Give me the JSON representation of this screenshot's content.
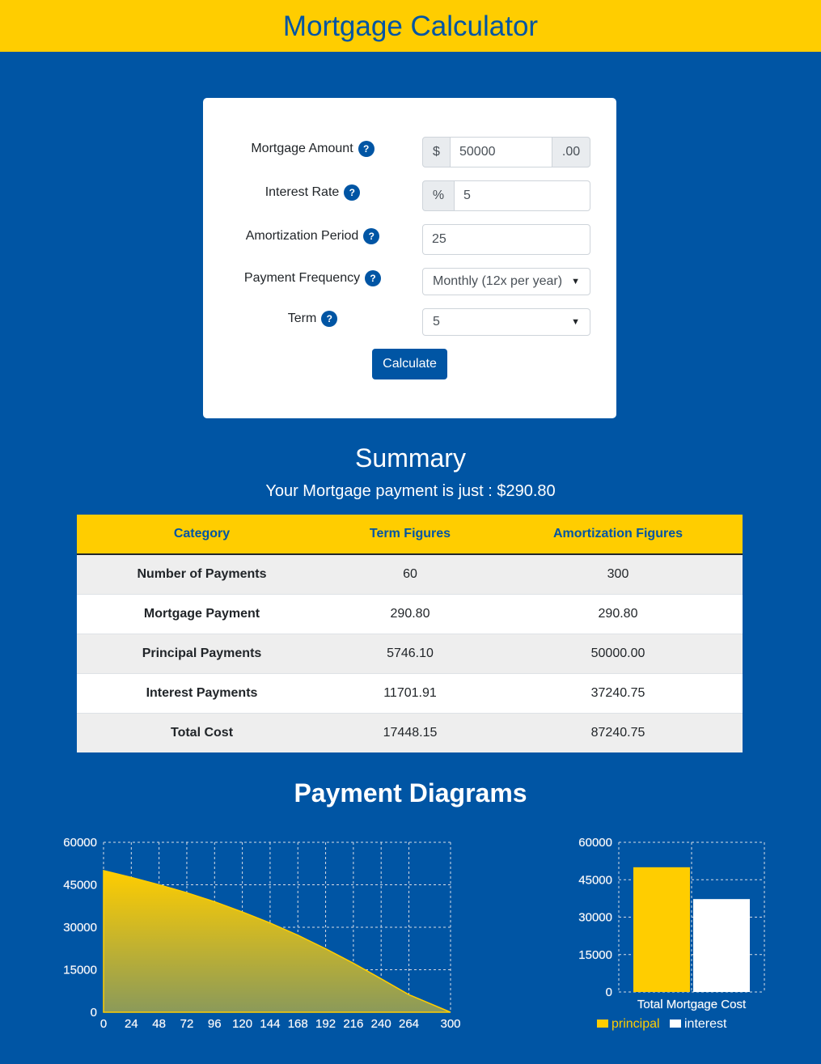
{
  "header": {
    "title": "Mortgage Calculator"
  },
  "form": {
    "mortgage_amount": {
      "label": "Mortgage Amount",
      "prefix": "$",
      "value": "50000",
      "suffix": ".00"
    },
    "interest_rate": {
      "label": "Interest Rate",
      "prefix": "%",
      "value": "5"
    },
    "amortization_period": {
      "label": "Amortization Period",
      "value": "25"
    },
    "payment_frequency": {
      "label": "Payment Frequency",
      "selected": "Monthly (12x per year)"
    },
    "term": {
      "label": "Term",
      "selected": "5"
    },
    "help_glyph": "?",
    "calculate_label": "Calculate"
  },
  "summary": {
    "title": "Summary",
    "subtitle": "Your Mortgage payment is just : $290.80",
    "headers": [
      "Category",
      "Term Figures",
      "Amortization Figures"
    ],
    "rows": [
      {
        "category": "Number of Payments",
        "term": "60",
        "amortization": "300"
      },
      {
        "category": "Mortgage Payment",
        "term": "290.80",
        "amortization": "290.80"
      },
      {
        "category": "Principal Payments",
        "term": "5746.10",
        "amortization": "50000.00"
      },
      {
        "category": "Interest Payments",
        "term": "11701.91",
        "amortization": "37240.75"
      },
      {
        "category": "Total Cost",
        "term": "17448.15",
        "amortization": "87240.75"
      }
    ]
  },
  "diagrams_title": "Payment Diagrams",
  "colors": {
    "brand_blue": "#0055a4",
    "brand_yellow": "#ffcd00"
  },
  "chart_data": [
    {
      "type": "area",
      "title": "",
      "xlabel": "",
      "ylabel": "",
      "x_ticks": [
        0,
        24,
        48,
        72,
        96,
        120,
        144,
        168,
        192,
        216,
        240,
        264,
        300
      ],
      "y_ticks": [
        0,
        15000,
        30000,
        45000,
        60000
      ],
      "ylim": [
        0,
        60000
      ],
      "grid": true,
      "series": [
        {
          "x": [
            0,
            24,
            48,
            72,
            96,
            120,
            144,
            168,
            192,
            216,
            240,
            264,
            300
          ],
          "values": [
            50000,
            47600,
            45000,
            42200,
            39000,
            35400,
            31500,
            27200,
            22400,
            17300,
            11800,
            6200,
            0
          ]
        }
      ]
    },
    {
      "type": "bar",
      "title": "",
      "categories": [
        "Total Mortgage Cost"
      ],
      "y_ticks": [
        0,
        15000,
        30000,
        45000,
        60000
      ],
      "ylim": [
        0,
        60000
      ],
      "grid": true,
      "legend_position": "bottom",
      "series": [
        {
          "name": "principal",
          "values": [
            50000
          ],
          "color": "#ffcd00"
        },
        {
          "name": "interest",
          "values": [
            37240.75
          ],
          "color": "#ffffff"
        }
      ]
    }
  ]
}
